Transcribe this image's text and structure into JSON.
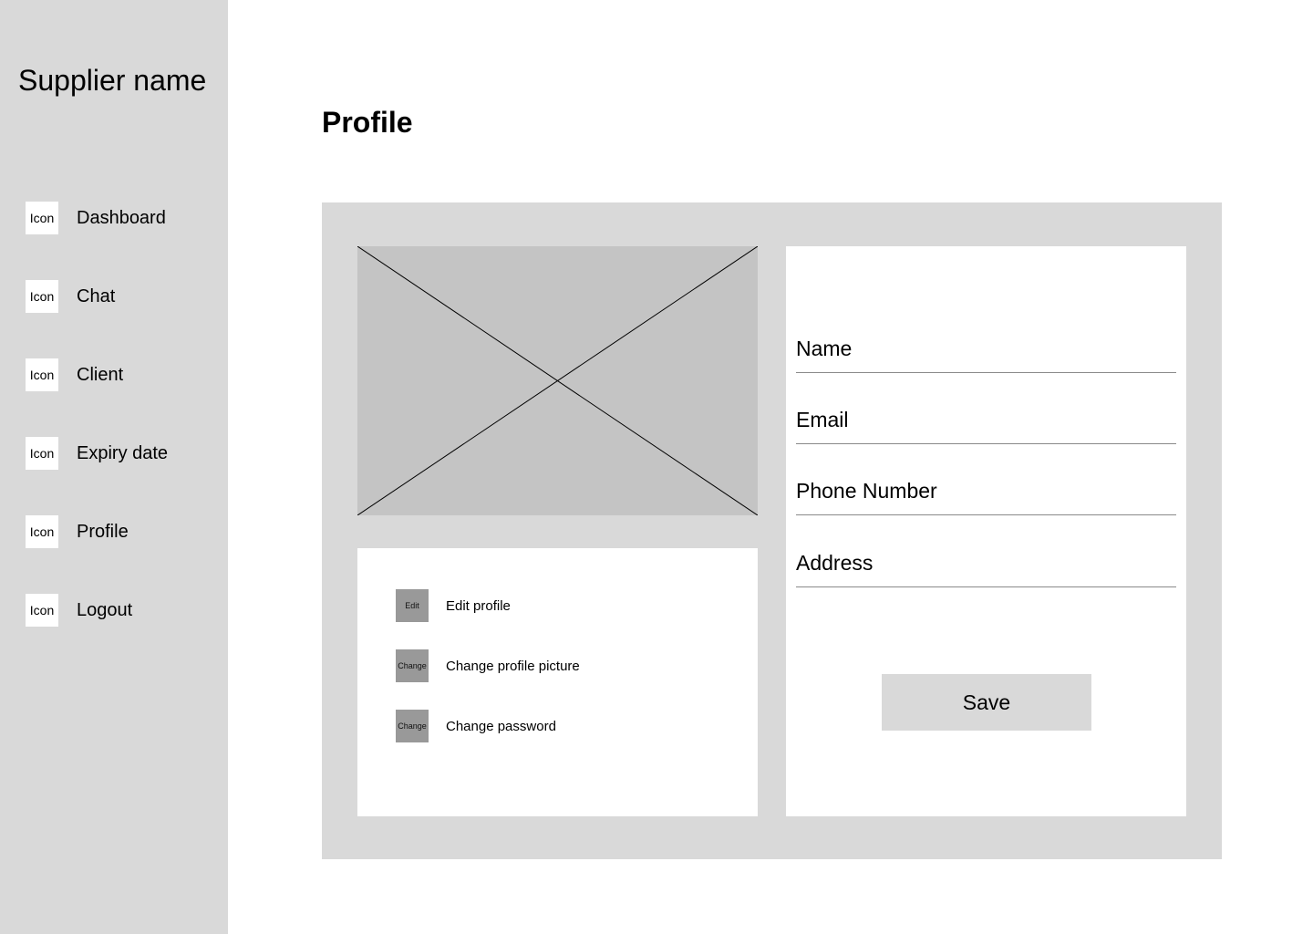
{
  "sidebar": {
    "brand": "Supplier name",
    "items": [
      {
        "icon": "Icon",
        "label": "Dashboard"
      },
      {
        "icon": "Icon",
        "label": "Chat"
      },
      {
        "icon": "Icon",
        "label": "Client"
      },
      {
        "icon": "Icon",
        "label": "Expiry date"
      },
      {
        "icon": "Icon",
        "label": "Profile"
      },
      {
        "icon": "Icon",
        "label": "Logout"
      }
    ]
  },
  "main": {
    "title": "Profile"
  },
  "actions": [
    {
      "icon": "Edit",
      "label": "Edit profile"
    },
    {
      "icon": "Change",
      "label": "Change profile picture"
    },
    {
      "icon": "Change",
      "label": "Change password"
    }
  ],
  "form": {
    "fields": [
      {
        "label": "Name"
      },
      {
        "label": "Email"
      },
      {
        "label": "Phone Number"
      },
      {
        "label": "Address"
      }
    ],
    "save_label": "Save"
  },
  "colors": {
    "sidebar_bg": "#d9d9d9",
    "panel_bg": "#d9d9d9",
    "placeholder_bg": "#c4c4c4",
    "action_icon_bg": "#999999"
  }
}
